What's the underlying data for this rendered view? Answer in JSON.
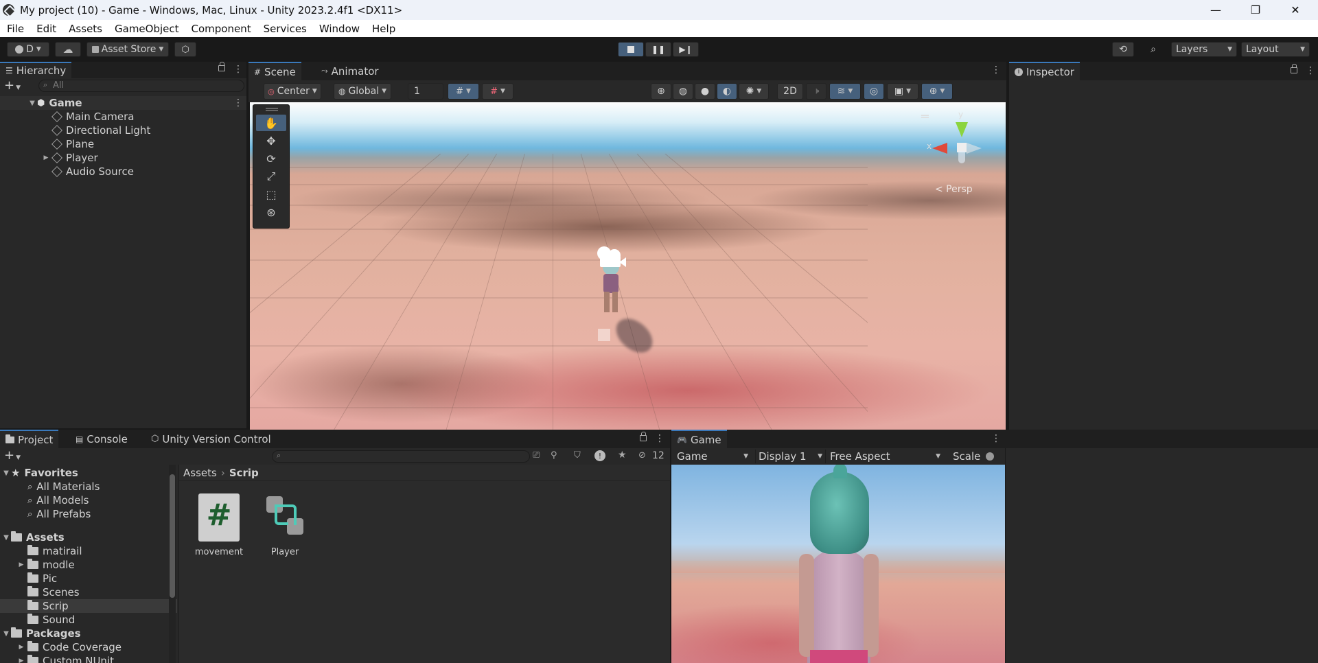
{
  "window": {
    "title": "My project (10) - Game - Windows, Mac, Linux - Unity 2023.2.4f1 <DX11>",
    "controls": [
      "—",
      "❐",
      "✕"
    ]
  },
  "menu": [
    "File",
    "Edit",
    "Assets",
    "GameObject",
    "Component",
    "Services",
    "Window",
    "Help"
  ],
  "toolbar": {
    "account_label": "D",
    "asset_store_label": "Asset Store",
    "layers_label": "Layers",
    "layout_label": "Layout"
  },
  "hierarchy": {
    "tab_label": "Hierarchy",
    "search_placeholder": "All",
    "scene_name": "Game",
    "items": [
      "Main Camera",
      "Directional Light",
      "Plane",
      "Player",
      "Audio Source"
    ]
  },
  "scene": {
    "tabs": [
      "Scene",
      "Animator"
    ],
    "pivot_label": "Center",
    "space_label": "Global",
    "grid_snap_value": "1",
    "mode_2d_label": "2D",
    "persp_label": "< Persp",
    "axis_y_label": "y",
    "axis_x_label": "x"
  },
  "inspector": {
    "tab_label": "Inspector"
  },
  "project": {
    "tabs": [
      "Project",
      "Console",
      "Unity Version Control"
    ],
    "hidden_count": "12",
    "favorites_label": "Favorites",
    "favorites": [
      "All Materials",
      "All Models",
      "All Prefabs"
    ],
    "assets_label": "Assets",
    "asset_folders": [
      "matirail",
      "modle",
      "Pic",
      "Scenes",
      "Scrip",
      "Sound"
    ],
    "packages_label": "Packages",
    "package_folders": [
      "Code Coverage",
      "Custom NUnit"
    ],
    "breadcrumb": [
      "Assets",
      "Scrip"
    ],
    "files": [
      {
        "name": "movement",
        "icon": "csharp-script-icon"
      },
      {
        "name": "Player",
        "icon": "input-actions-icon"
      }
    ]
  },
  "game": {
    "tab_label": "Game",
    "mode_label": "Game",
    "display_label": "Display 1",
    "aspect_label": "Free Aspect",
    "scale_label": "Scale"
  },
  "colors": {
    "accent_blue": "#3a79bb",
    "selected_button": "#46607c",
    "panel_bg": "#282828",
    "toolbar_bg": "#191919"
  }
}
